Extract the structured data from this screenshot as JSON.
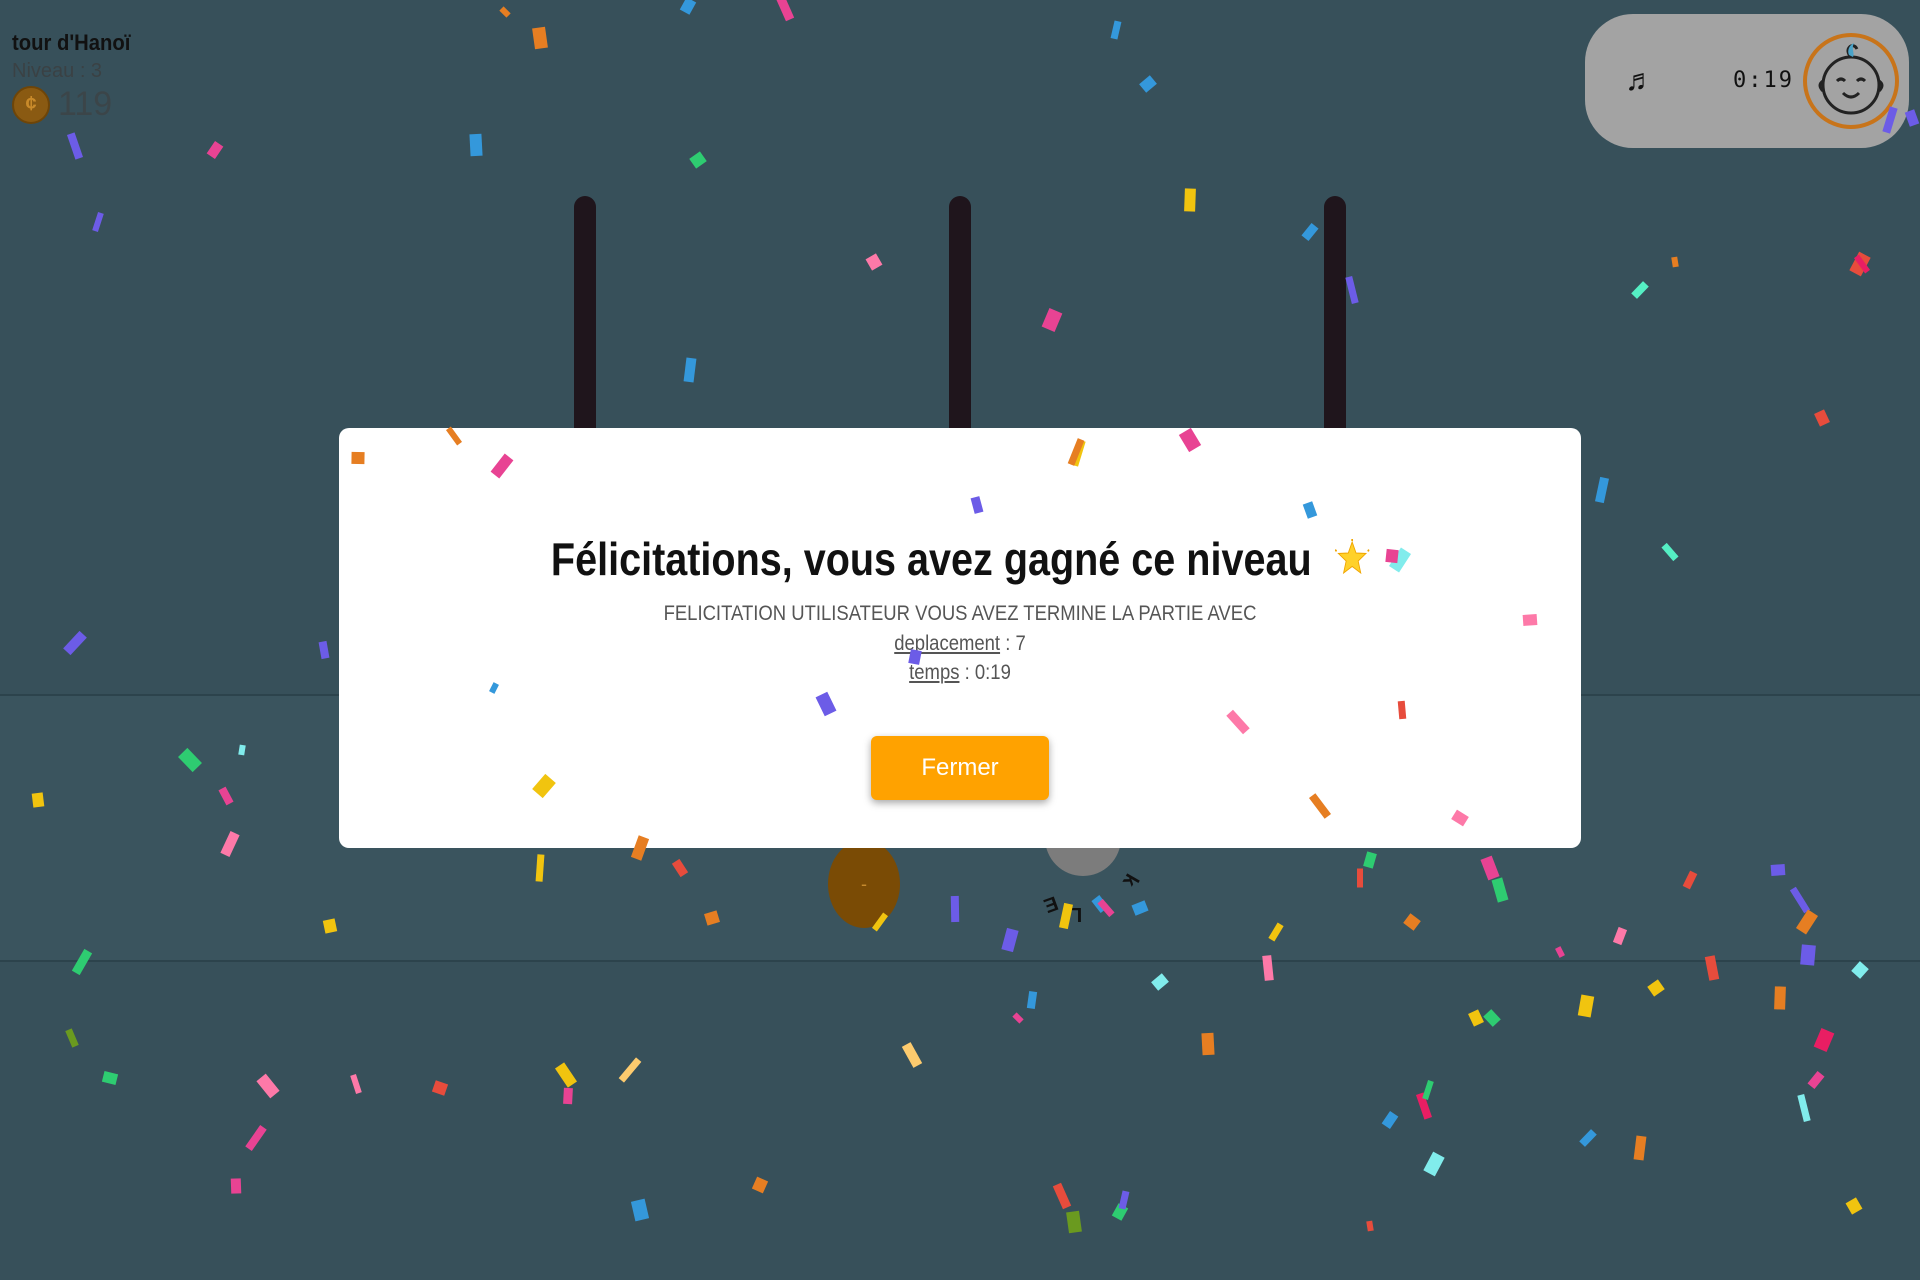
{
  "hud": {
    "title": "tour d'Hanoï",
    "level_label": "Niveau : 3",
    "coin_count": "119"
  },
  "topbar": {
    "music_icon": "music-note-icon",
    "timer": "0:19",
    "avatar_icon": "baby-face-icon"
  },
  "modal": {
    "title": "Félicitations, vous avez gagné ce niveau",
    "title_icon": "star-icon",
    "message": "FELICITATION UTILISATEUR VOUS AVEZ TERMINE LA PARTIE AVEC",
    "moves_label": "deplacement",
    "moves_value": "7",
    "time_label": "temps",
    "time_value": "0:19",
    "close_label": "Fermer"
  },
  "colors": {
    "background": "#37505a",
    "accent_button": "#ffa200",
    "peg": "#1f151c",
    "avatar_ring": "#c8741a",
    "confetti": [
      "#6c5ce7",
      "#e67e22",
      "#3498db",
      "#e84393",
      "#2ecc71",
      "#f1c40f",
      "#e74c3c",
      "#fd79a8",
      "#81ecec",
      "#55efc4",
      "#fdcb6e",
      "#6a9a1f",
      "#e91e63",
      "#a29bfe"
    ]
  }
}
